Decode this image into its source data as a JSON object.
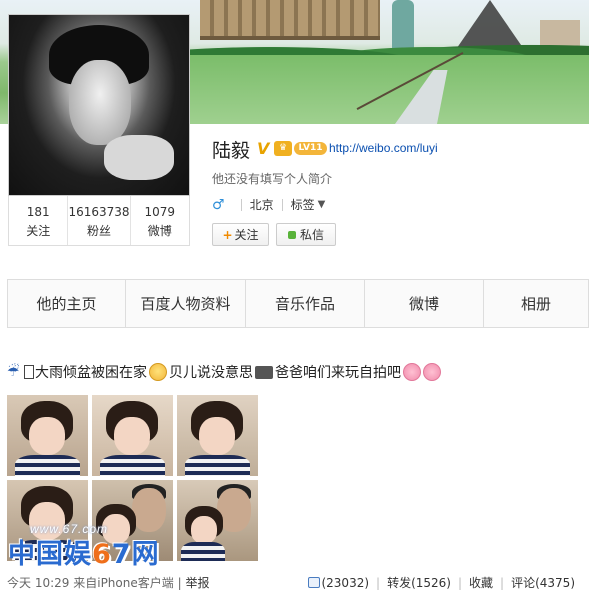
{
  "profile": {
    "name": "陆毅",
    "verified_mark": "V",
    "level_badge": "LV11",
    "url": "http://weibo.com/luyi",
    "bio": "他还没有填写个人简介",
    "gender_symbol": "♂",
    "location": "北京",
    "tags_label": "标签",
    "tags_caret": "▼"
  },
  "stats": [
    {
      "value": "181",
      "label": "关注"
    },
    {
      "value": "16163738",
      "label": "粉丝"
    },
    {
      "value": "1079",
      "label": "微博"
    }
  ],
  "buttons": {
    "follow_plus": "+",
    "follow_label": "关注",
    "message_label": "私信"
  },
  "nav": {
    "tabs": [
      "他的主页",
      "百度人物资料",
      "音乐作品",
      "微博",
      "相册"
    ]
  },
  "post": {
    "text_1": "大雨倾盆被困在家",
    "text_2": "贝儿说没意思",
    "text_3": "爸爸咱们来玩自拍吧",
    "umbrella_glyph": "☔"
  },
  "watermark": {
    "url": "www.67.com",
    "text_a": "中国娱",
    "text_b": "6",
    "text_c": "7网"
  },
  "footer": {
    "time": "今天 10:29",
    "source": "来自iPhone客户端",
    "divider": "|",
    "report": "举报",
    "likes": "(23032)",
    "repost": "转发(1526)",
    "favorite": "收藏",
    "comment": "评论(4375)",
    "sep": "|"
  },
  "colors": {
    "link": "#0a4fb0",
    "gender": "#2f8fd8",
    "badge": "#f3b53a",
    "watermark_blue": "#2a6bd0",
    "watermark_orange": "#ef6f1b"
  }
}
